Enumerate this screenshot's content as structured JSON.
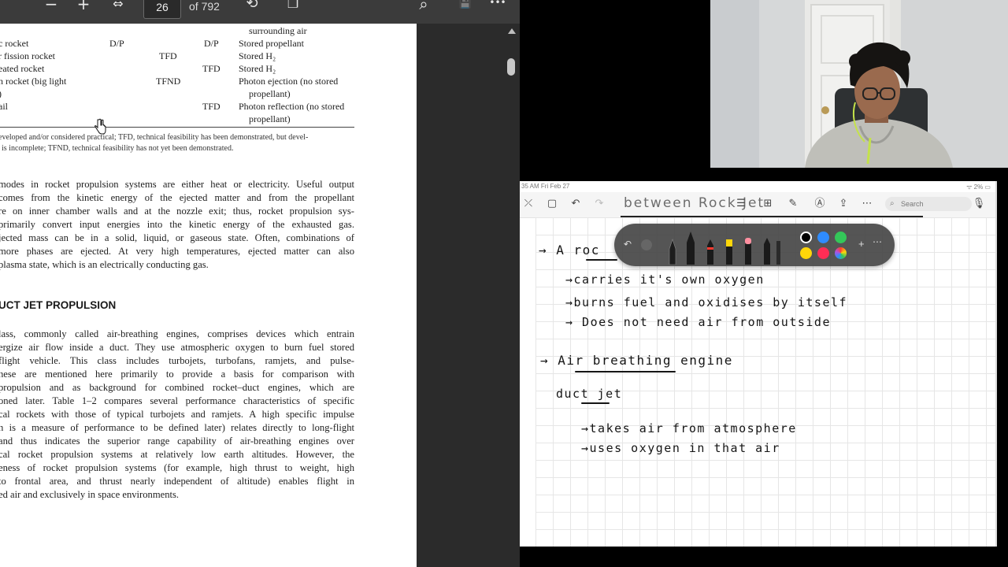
{
  "pdf": {
    "toolbar": {
      "zoom_out": "−",
      "zoom_in": "+",
      "fit_width": "⇔",
      "current_page": "26",
      "page_total": "of 792",
      "rotate": "⟲",
      "page_view": "❐",
      "search": "⌕",
      "save": "💾",
      "more": "•••"
    },
    "table_rows": [
      {
        "col1": "",
        "col2": "",
        "col3": "",
        "col4": "surrounding air"
      },
      {
        "col1": "c rocket",
        "col2": "D/P",
        "col3": "D/P",
        "col4": "Stored propellant"
      },
      {
        "col1": "r fission rocket",
        "col2": "TFD",
        "col3": "",
        "col4": "Stored H₂"
      },
      {
        "col1": "eated rocket",
        "col2": "",
        "col3": "TFD",
        "col4": "Stored H₂"
      },
      {
        "col1": "n rocket (big light",
        "col2": "TFND",
        "col3": "",
        "col4": "Photon ejection (no stored"
      },
      {
        "col1": ")",
        "col2": "",
        "col3": "",
        "col4": "propellant)"
      },
      {
        "col1": "ail",
        "col2": "",
        "col3": "TFD",
        "col4": "Photon reflection (no stored"
      },
      {
        "col1": "",
        "col2": "",
        "col3": "",
        "col4": "propellant)"
      }
    ],
    "footnote": [
      "eveloped and/or considered practical; TFD, technical feasibility has been demonstrated, but devel-",
      "is incomplete; TFND, technical feasibility has not yet been demonstrated."
    ],
    "paragraph1": [
      "modes in rocket propulsion systems are either heat or electricity. Useful output",
      "comes from the kinetic energy of the ejected matter and from the propellant",
      "re on inner chamber walls and at the nozzle exit; thus, rocket propulsion sys-",
      "primarily convert input energies into the kinetic energy of the exhausted gas.",
      "jected mass can be in a solid, liquid, or gaseous state. Often, combinations of",
      "more phases are ejected. At very high temperatures, ejected matter can also",
      "plasma state, which is an electrically conducting gas."
    ],
    "section_heading": "UCT JET PROPULSION",
    "paragraph2": [
      "lass, commonly called air-breathing engines, comprises devices which entrain",
      "ergize air flow inside a duct. They use atmospheric oxygen to burn fuel stored",
      "flight vehicle. This class includes turbojets, turbofans, ramjets, and pulse-",
      "hese are mentioned here primarily to provide a basis for comparison with",
      "propulsion and as background for combined rocket–duct engines, which are",
      "oned later. Table 1–2 compares several performance characteristics of specific",
      "cal rockets with those of typical turbojets and ramjets. A high specific impulse",
      "h is a measure of performance to be defined later) relates directly to long-flight",
      "and thus indicates the superior range capability of air-breathing engines over",
      "cal rocket propulsion systems at relatively low earth altitudes. However, the",
      "eness of rocket propulsion systems (for example, high thrust to weight, high",
      "to frontal area, and thrust nearly independent of altitude) enables flight in",
      "ed air and exclusively in space environments."
    ]
  },
  "ipad": {
    "status_time": "35 AM   Fri Feb 27",
    "status_battery": "ᯤ 2% ▭",
    "note_title": "between Rock Jet",
    "search_placeholder": "Search",
    "notes": {
      "line1": "→ A  roc",
      "line2": "→carries it's own oxygen",
      "line3": "→burns fuel and oxidises by itself",
      "line4": "→ Does not need air from outside",
      "line5": "→ Air breathing engine",
      "line6": "duct jet",
      "line7": "→takes air from atmosphere",
      "line8": "→uses oxygen in that air"
    },
    "palette_colors": [
      "#000000",
      "#2f8cff",
      "#34c759",
      "#ffd60a",
      "#ff2d55"
    ]
  }
}
